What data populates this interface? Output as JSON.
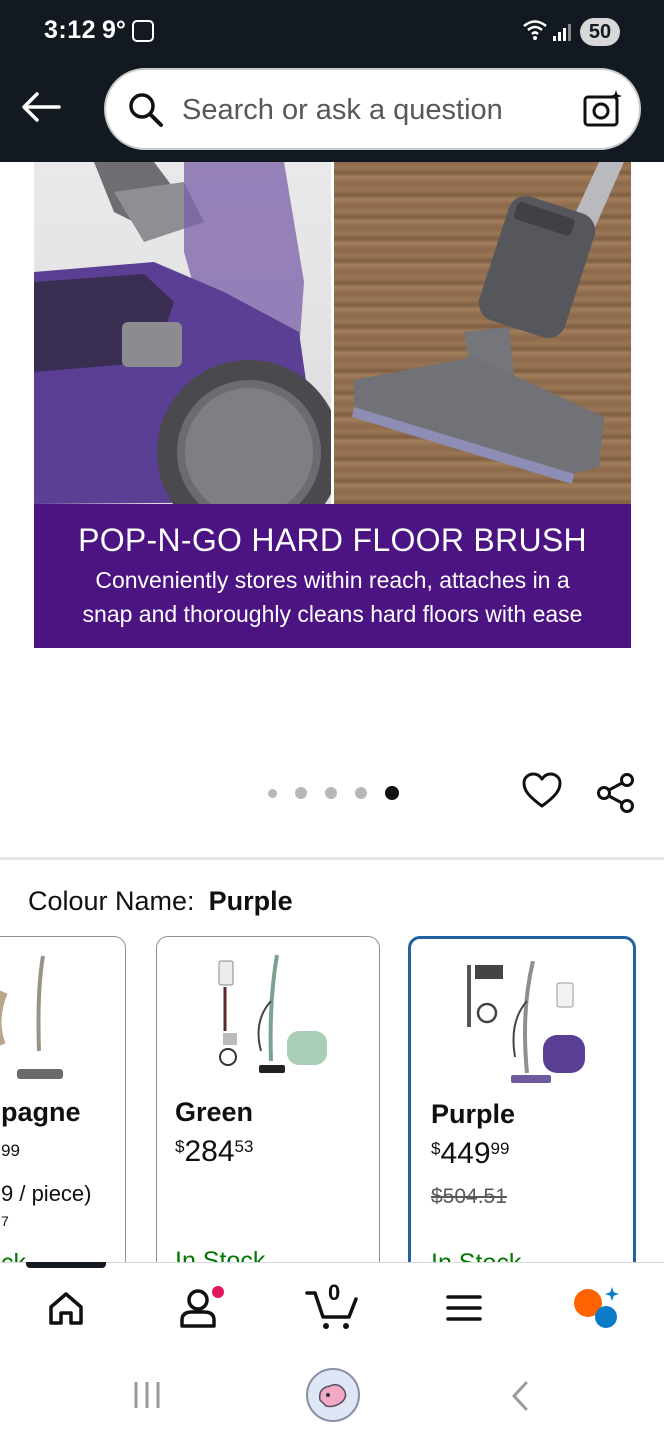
{
  "status_bar": {
    "time": "3:12",
    "temperature": "9°",
    "battery": "50"
  },
  "search": {
    "placeholder": "Search or ask a question"
  },
  "hero": {
    "banner_title": "POP-N-GO HARD FLOOR BRUSH",
    "banner_line1": "Conveniently stores within reach, attaches in a",
    "banner_line2": "snap and thoroughly cleans hard floors with ease",
    "carousel": {
      "count": 5,
      "active_index": 4
    }
  },
  "colour": {
    "label": "Colour Name:",
    "selected": "Purple"
  },
  "swatches": [
    {
      "name": "pagne",
      "price_line": "99",
      "per_unit": "9 / piece)",
      "extra": "7",
      "stock": "ck"
    },
    {
      "name": "Green",
      "price_symbol": "$",
      "price_whole": "284",
      "price_fraction": "53",
      "stock": "In Stock"
    },
    {
      "name": "Purple",
      "price_symbol": "$",
      "price_whole": "449",
      "price_fraction": "99",
      "list_price": "$504.51",
      "stock": "In Stock",
      "selected": true
    }
  ],
  "bottom_nav": {
    "cart_count": "0",
    "items": [
      "home-icon",
      "account-icon",
      "cart-icon",
      "menu-icon",
      "rufus-icon"
    ]
  },
  "colors": {
    "header_bg": "#131921",
    "banner_purple": "#4b1482",
    "selected_border": "#2162a1",
    "in_stock": "#007600",
    "notification_dot": "#e3165b"
  }
}
